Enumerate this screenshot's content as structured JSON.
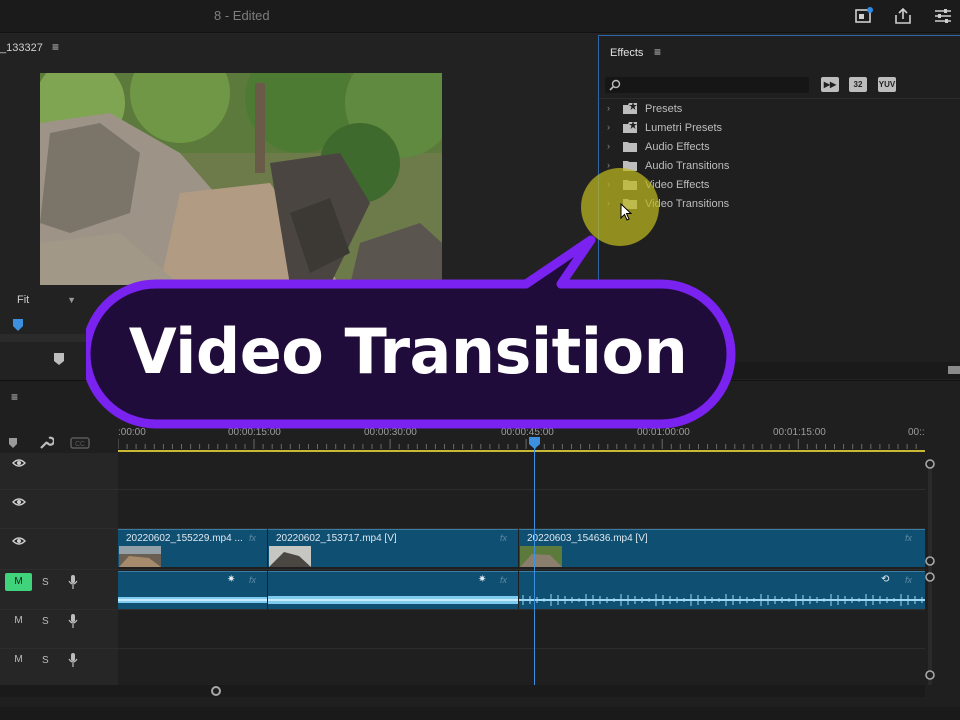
{
  "window": {
    "title": "8 - Edited"
  },
  "top_icons": [
    "program-monitor-icon",
    "share-icon",
    "menu-icon"
  ],
  "program_monitor": {
    "sequence_name": "_133327",
    "fit_select": "Fit"
  },
  "effects_panel": {
    "title": "Effects",
    "search_placeholder": "",
    "filter_buttons": [
      "32",
      "YUV"
    ],
    "items": [
      {
        "label": "Presets",
        "icon": "presets-folder-icon"
      },
      {
        "label": "Lumetri Presets",
        "icon": "presets-folder-icon"
      },
      {
        "label": "Audio Effects",
        "icon": "folder-icon"
      },
      {
        "label": "Audio Transitions",
        "icon": "folder-icon"
      },
      {
        "label": "Video Effects",
        "icon": "folder-icon"
      },
      {
        "label": "Video Transitions",
        "icon": "folder-icon"
      }
    ]
  },
  "callout": {
    "text": "Video Transition"
  },
  "timeline": {
    "ruler_labels": [
      ":00:00",
      "00:00:15:00",
      "00:00:30:00",
      "00:00:45:00",
      "00:01:00:00",
      "00:01:15:00",
      "00::"
    ],
    "track_controls": {
      "mute": "M",
      "solo": "S"
    },
    "video_clips": [
      {
        "name": "20220602_155229.mp4 ...",
        "fx": "fx"
      },
      {
        "name": "20220602_153717.mp4 [V]",
        "fx": "fx"
      },
      {
        "name": "20220603_154636.mp4 [V]",
        "fx": "fx"
      }
    ],
    "audio_clips": [
      {
        "fx": "fx"
      },
      {
        "fx": "fx"
      },
      {
        "fx": "fx"
      }
    ]
  },
  "colors": {
    "accent_blue": "#3d8fe0",
    "clip_blue": "#0f4f72",
    "callout_purple": "#7a22f0",
    "callout_fill": "#200c3a",
    "mute_active": "#3fd37c",
    "cursor_highlight": "#bebb1e"
  }
}
